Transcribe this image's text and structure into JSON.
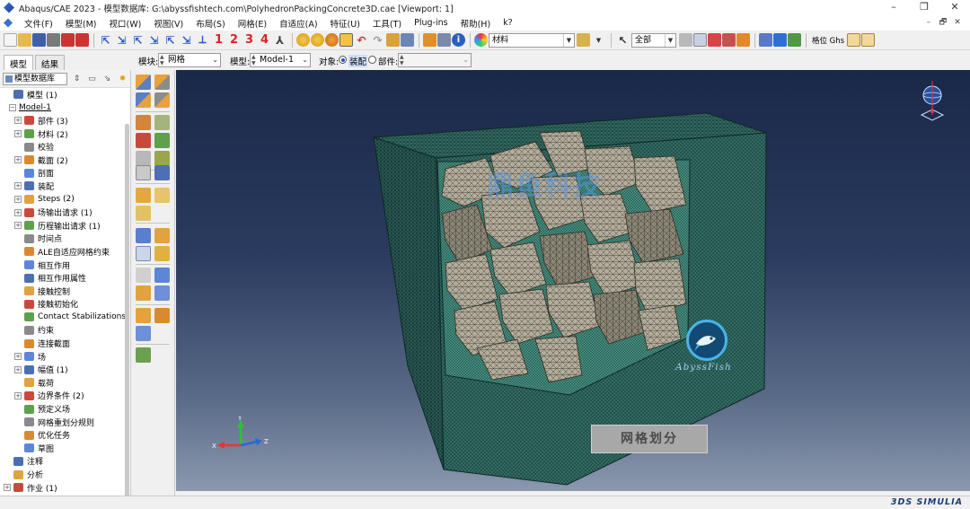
{
  "window": {
    "title": "Abaqus/CAE 2023 - 模型数据库: G:\\abyssfishtech.com\\PolyhedronPackingConcrete3D.cae [Viewport: 1]",
    "controls": [
      "–",
      "❐",
      "✕"
    ]
  },
  "menubar": {
    "items": [
      "文件(F)",
      "模型(M)",
      "视口(W)",
      "视图(V)",
      "布局(S)",
      "网格(E)",
      "自适应(A)",
      "特征(U)",
      "工具(T)",
      "Plug-ins",
      "帮助(H)",
      "k?"
    ],
    "mdi_controls": [
      "–",
      "🗗",
      "✕"
    ]
  },
  "toolbar": {
    "numbers": [
      "1",
      "2",
      "3",
      "4"
    ],
    "material_combo": "材料",
    "selection_combo": "全部",
    "mesh_button": "格位 Ghs"
  },
  "context": {
    "tabs": [
      "模型",
      "结果"
    ],
    "module_label": "模块:",
    "module_value": "网格",
    "model_label": "模型:",
    "model_value": "Model-1",
    "object_label": "对象:",
    "object_assembly": "装配",
    "object_part": "部件:",
    "part_value": ""
  },
  "tree": {
    "combo": "模型数据库",
    "rows": [
      {
        "label": "模型 (1)",
        "indent": 0,
        "exp": "",
        "icon": "models-icon"
      },
      {
        "label": "Model-1",
        "indent": 1,
        "exp": "−",
        "icon": "",
        "underline": true
      },
      {
        "label": "部件 (3)",
        "indent": 2,
        "exp": "+",
        "icon": "parts-icon"
      },
      {
        "label": "材料 (2)",
        "indent": 2,
        "exp": "+",
        "icon": "materials-icon"
      },
      {
        "label": "校验",
        "indent": 2,
        "exp": "",
        "icon": "calibration-icon"
      },
      {
        "label": "截面 (2)",
        "indent": 2,
        "exp": "+",
        "icon": "sections-icon"
      },
      {
        "label": "剖面",
        "indent": 2,
        "exp": "",
        "icon": "profiles-icon"
      },
      {
        "label": "装配",
        "indent": 2,
        "exp": "+",
        "icon": "assembly-icon"
      },
      {
        "label": "Steps (2)",
        "indent": 2,
        "exp": "+",
        "icon": "steps-icon"
      },
      {
        "label": "场输出请求 (1)",
        "indent": 2,
        "exp": "+",
        "icon": "field-output-icon"
      },
      {
        "label": "历程输出请求 (1)",
        "indent": 2,
        "exp": "+",
        "icon": "history-output-icon"
      },
      {
        "label": "时间点",
        "indent": 2,
        "exp": "",
        "icon": "time-points-icon"
      },
      {
        "label": "ALE自适应网格约束",
        "indent": 2,
        "exp": "",
        "icon": "ale-icon"
      },
      {
        "label": "相互作用",
        "indent": 2,
        "exp": "",
        "icon": "interactions-icon"
      },
      {
        "label": "相互作用属性",
        "indent": 2,
        "exp": "",
        "icon": "interaction-props-icon"
      },
      {
        "label": "接触控制",
        "indent": 2,
        "exp": "",
        "icon": "contact-controls-icon"
      },
      {
        "label": "接触初始化",
        "indent": 2,
        "exp": "",
        "icon": "contact-init-icon"
      },
      {
        "label": "Contact Stabilizations",
        "indent": 2,
        "exp": "",
        "icon": "contact-stab-icon"
      },
      {
        "label": "约束",
        "indent": 2,
        "exp": "",
        "icon": "constraints-icon"
      },
      {
        "label": "连接截面",
        "indent": 2,
        "exp": "",
        "icon": "connector-sections-icon"
      },
      {
        "label": "场",
        "indent": 2,
        "exp": "+",
        "icon": "fields-icon"
      },
      {
        "label": "幅值 (1)",
        "indent": 2,
        "exp": "+",
        "icon": "amplitudes-icon"
      },
      {
        "label": "载荷",
        "indent": 2,
        "exp": "",
        "icon": "loads-icon"
      },
      {
        "label": "边界条件 (2)",
        "indent": 2,
        "exp": "+",
        "icon": "bcs-icon"
      },
      {
        "label": "预定义场",
        "indent": 2,
        "exp": "",
        "icon": "predefined-fields-icon"
      },
      {
        "label": "网格重划分规则",
        "indent": 2,
        "exp": "",
        "icon": "remesh-rules-icon"
      },
      {
        "label": "优化任务",
        "indent": 2,
        "exp": "",
        "icon": "optimization-icon"
      },
      {
        "label": "草图",
        "indent": 2,
        "exp": "",
        "icon": "sketches-icon"
      },
      {
        "label": "注释",
        "indent": 0,
        "exp": "",
        "icon": "annotations-icon"
      },
      {
        "label": "分析",
        "indent": 0,
        "exp": "",
        "icon": "analysis-icon"
      },
      {
        "label": "作业 (1)",
        "indent": 0,
        "exp": "+",
        "icon": "jobs-icon"
      }
    ]
  },
  "viewport": {
    "watermark_brand": "鼎鱼科技",
    "logo_text": "AbyssFish",
    "mesh_label": "网格划分",
    "triad": {
      "y": "Y",
      "x": "X",
      "z": "Z"
    }
  },
  "status": {
    "brand": "3DS SIMULIA"
  },
  "colors": {
    "accent_blue": "#1a57c8",
    "viewport_top": "#1a2848",
    "viewport_bottom": "#8b98ae",
    "mesh_green": "#1f4a44",
    "aggregate": "#b3ad9c"
  }
}
